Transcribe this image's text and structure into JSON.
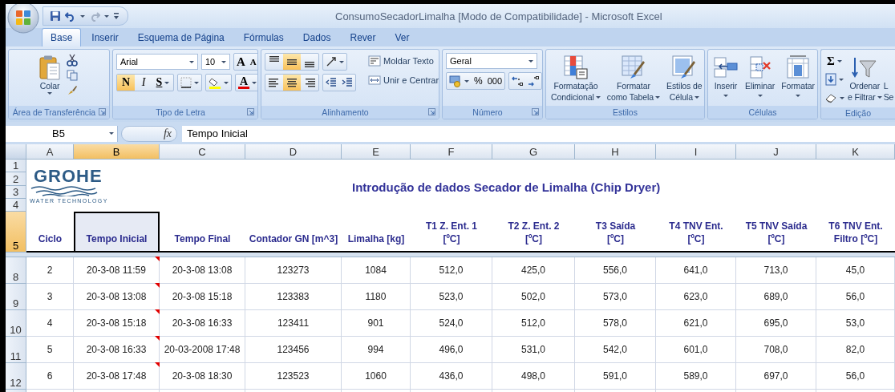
{
  "window": {
    "title": "ConsumoSecadorLimalha  [Modo de Compatibilidade] - Microsoft Excel"
  },
  "tabs": [
    {
      "label": "Base",
      "selected": true
    },
    {
      "label": "Inserir",
      "selected": false
    },
    {
      "label": "Esquema de Página",
      "selected": false
    },
    {
      "label": "Fórmulas",
      "selected": false
    },
    {
      "label": "Dados",
      "selected": false
    },
    {
      "label": "Rever",
      "selected": false
    },
    {
      "label": "Ver",
      "selected": false
    }
  ],
  "ribbon": {
    "groups": [
      {
        "kind": "clipboard",
        "label": "Área de Transferência",
        "launcher": true,
        "paste": "Colar"
      },
      {
        "kind": "font",
        "label": "Tipo de Letra",
        "launcher": true,
        "font": "Arial",
        "size": "10",
        "grow": "A",
        "shrink": "A",
        "styles": [
          {
            "glyph": "N",
            "selected": true
          },
          {
            "glyph": "I",
            "selected": false
          },
          {
            "glyph": "S",
            "selected": false
          }
        ],
        "font_color": "A"
      },
      {
        "kind": "alignment",
        "label": "Alinhamento",
        "launcher": true,
        "vertical": [
          {
            "selected": false
          },
          {
            "selected": true
          },
          {
            "selected": false
          }
        ],
        "horizontal": [
          {
            "selected": false
          },
          {
            "selected": true
          },
          {
            "selected": false
          }
        ],
        "wrap": "Moldar Texto",
        "merge": "Unir e Centrar"
      },
      {
        "kind": "number",
        "label": "Número",
        "launcher": true,
        "format": "Geral",
        "percent": "%",
        "thousands": "000"
      },
      {
        "kind": "styles",
        "label": "Estilos",
        "launcher": false,
        "buttons": [
          {
            "lines": [
              "Formatação",
              "Condicional"
            ]
          },
          {
            "lines": [
              "Formatar",
              "como Tabela"
            ]
          },
          {
            "lines": [
              "Estilos de",
              "Célula"
            ]
          }
        ]
      },
      {
        "kind": "cells",
        "label": "Células",
        "launcher": false,
        "buttons": [
          {
            "lines": [
              "Inserir"
            ]
          },
          {
            "lines": [
              "Eliminar"
            ]
          },
          {
            "lines": [
              "Formatar"
            ]
          }
        ]
      },
      {
        "kind": "editing",
        "label": "Edição",
        "launcher": false,
        "sum": "Σ",
        "buttons": [
          {
            "lines": [
              "Ordenar",
              "e Filtrar"
            ]
          },
          {
            "lines": [
              "L",
              "Se"
            ]
          }
        ]
      }
    ]
  },
  "formula_bar": {
    "name_box": "B5",
    "function": "fx",
    "value": "Tempo Inicial"
  },
  "sheet": {
    "columns": [
      {
        "letter": "A",
        "selected": false
      },
      {
        "letter": "B",
        "selected": true
      },
      {
        "letter": "C",
        "selected": false
      },
      {
        "letter": "D",
        "selected": false
      },
      {
        "letter": "E",
        "selected": false
      },
      {
        "letter": "F",
        "selected": false
      },
      {
        "letter": "G",
        "selected": false
      },
      {
        "letter": "H",
        "selected": false
      },
      {
        "letter": "I",
        "selected": false
      },
      {
        "letter": "J",
        "selected": false
      },
      {
        "letter": "K",
        "selected": false
      }
    ],
    "top_rows": [
      "1",
      "2",
      "3",
      "4"
    ],
    "logo": {
      "name": "GROHE",
      "tagline": "WATER TECHNOLOGY"
    },
    "title": "Introdução de dados Secador de Limalha (Chip Dryer)",
    "header_row": {
      "number": "5",
      "selected": true,
      "cells": [
        {
          "text": "Ciclo",
          "selected": false
        },
        {
          "text": "Tempo Inicial",
          "selected": true
        },
        {
          "text": "Tempo Final",
          "selected": false
        },
        {
          "text": "Contador GN [m^3]",
          "selected": false
        },
        {
          "text": "Limalha [kg]",
          "selected": false
        },
        {
          "text": "T1 Z. Ent. 1\n[ºC]",
          "selected": false
        },
        {
          "text": "T2 Z. Ent. 2\n[ºC]",
          "selected": false
        },
        {
          "text": "T3 Saída\n[ºC]",
          "selected": false
        },
        {
          "text": "T4 TNV Ent.\n[ºC]",
          "selected": false
        },
        {
          "text": "T5 TNV Saída\n[ºC]",
          "selected": false
        },
        {
          "text": "T6 TNV Ent.\nFiltro [ºC]",
          "selected": false
        }
      ]
    },
    "rows": [
      {
        "number": "8",
        "comment": true,
        "cells": [
          "2",
          "20-3-08 11:59",
          "20-3-08 13:08",
          "123273",
          "1084",
          "512,0",
          "425,0",
          "556,0",
          "641,0",
          "713,0",
          "45,0"
        ]
      },
      {
        "number": "9",
        "comment": true,
        "cells": [
          "3",
          "20-3-08 13:08",
          "20-3-08 15:18",
          "123383",
          "1180",
          "523,0",
          "502,0",
          "573,0",
          "623,0",
          "689,0",
          "56,0"
        ]
      },
      {
        "number": "10",
        "comment": true,
        "cells": [
          "4",
          "20-3-08 15:18",
          "20-3-08 16:33",
          "123411",
          "901",
          "524,0",
          "512,0",
          "578,0",
          "621,0",
          "695,0",
          "53,0"
        ]
      },
      {
        "number": "11",
        "comment": true,
        "cells": [
          "5",
          "20-3-08 16:33",
          "20-03-2008 17:48",
          "123456",
          "994",
          "496,0",
          "531,0",
          "542,0",
          "601,0",
          "708,0",
          "82,0"
        ]
      },
      {
        "number": "12",
        "comment": true,
        "cells": [
          "6",
          "20-3-08 17:48",
          "20-3-08 18:30",
          "123523",
          "1060",
          "436,0",
          "498,0",
          "591,0",
          "589,0",
          "697,0",
          "56,0"
        ]
      }
    ]
  }
}
